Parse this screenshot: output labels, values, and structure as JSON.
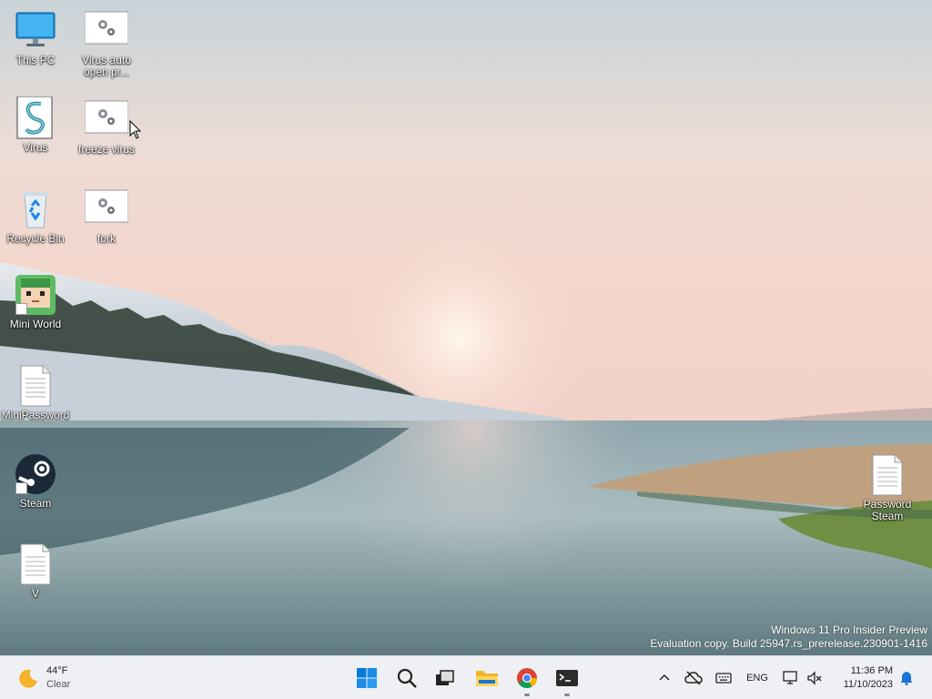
{
  "desktop": {
    "icons": [
      {
        "label": "This PC"
      },
      {
        "label": "Virus auto open pr..."
      },
      {
        "label": "Virus"
      },
      {
        "label": "freeze virus"
      },
      {
        "label": "Recycle Bin"
      },
      {
        "label": "fork"
      },
      {
        "label": "Mini World"
      },
      {
        "label": "MiniPassword"
      },
      {
        "label": "Steam"
      },
      {
        "label": "V"
      },
      {
        "label": "Password Steam"
      }
    ],
    "watermark": {
      "line1": "Windows 11 Pro Insider Preview",
      "line2": "Evaluation copy. Build 25947.rs_prerelease.230901-1416"
    }
  },
  "taskbar": {
    "weather": {
      "temp": "44°F",
      "condition": "Clear",
      "icon": "moon-icon"
    },
    "apps": [
      {
        "name": "start",
        "icon": "windows-logo-icon"
      },
      {
        "name": "search",
        "icon": "search-icon"
      },
      {
        "name": "task-view",
        "icon": "task-view-icon"
      },
      {
        "name": "file-explorer",
        "icon": "folder-icon"
      },
      {
        "name": "chrome",
        "icon": "chrome-icon"
      },
      {
        "name": "terminal",
        "icon": "terminal-icon"
      }
    ],
    "tray": {
      "language": "ENG"
    },
    "clock": {
      "time": "11:36 PM",
      "date": "11/10/2023"
    }
  }
}
